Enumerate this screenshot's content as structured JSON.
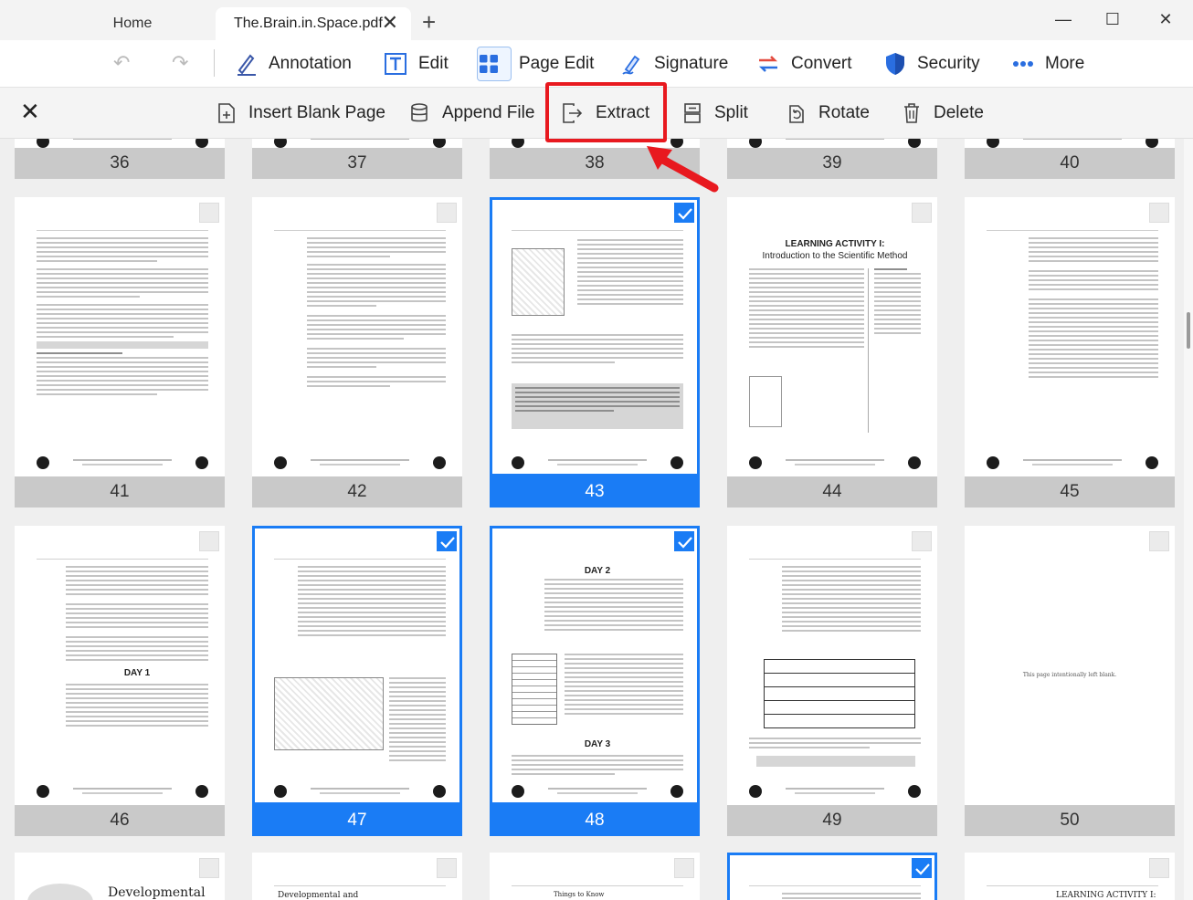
{
  "tabs": {
    "home": "Home",
    "active": "The.Brain.in.Space.pdf",
    "close_glyph": "✕",
    "new_glyph": "+"
  },
  "window": {
    "minimize_glyph": "—",
    "maximize_glyph": "☐",
    "close_glyph": "✕"
  },
  "toolbar": {
    "annotation": "Annotation",
    "edit": "Edit",
    "page_edit": "Page Edit",
    "signature": "Signature",
    "convert": "Convert",
    "security": "Security",
    "more": "More"
  },
  "subtoolbar": {
    "close_glyph": "✕",
    "insert_blank_page": "Insert Blank Page",
    "append_file": "Append File",
    "extract": "Extract",
    "split": "Split",
    "rotate": "Rotate",
    "delete": "Delete"
  },
  "colors": {
    "accent": "#1a7cf5",
    "highlight": "#e8191f"
  },
  "pages": {
    "p36": "36",
    "p37": "37",
    "p38": "38",
    "p39": "39",
    "p40": "40",
    "p41": "41",
    "p42": "42",
    "p43": "43",
    "p44": "44",
    "p45": "45",
    "p46": "46",
    "p47": "47",
    "p48": "48",
    "p49": "49",
    "p50": "50"
  },
  "selected_pages": [
    "43",
    "47",
    "48",
    "54"
  ],
  "page_text": {
    "p44_title": "LEARNING ACTIVITY I:",
    "p44_subtitle": "Introduction to the Scientific Method",
    "p46_heading": "DAY 1",
    "p48_heading": "DAY 2",
    "p48_heading2": "DAY 3",
    "p50_note": "This page intentionally left blank.",
    "p51_heading": "Developmental",
    "p52_heading": "Developmental and",
    "p53_heading": "Things to Know",
    "p55_heading": "LEARNING ACTIVITY I:"
  }
}
